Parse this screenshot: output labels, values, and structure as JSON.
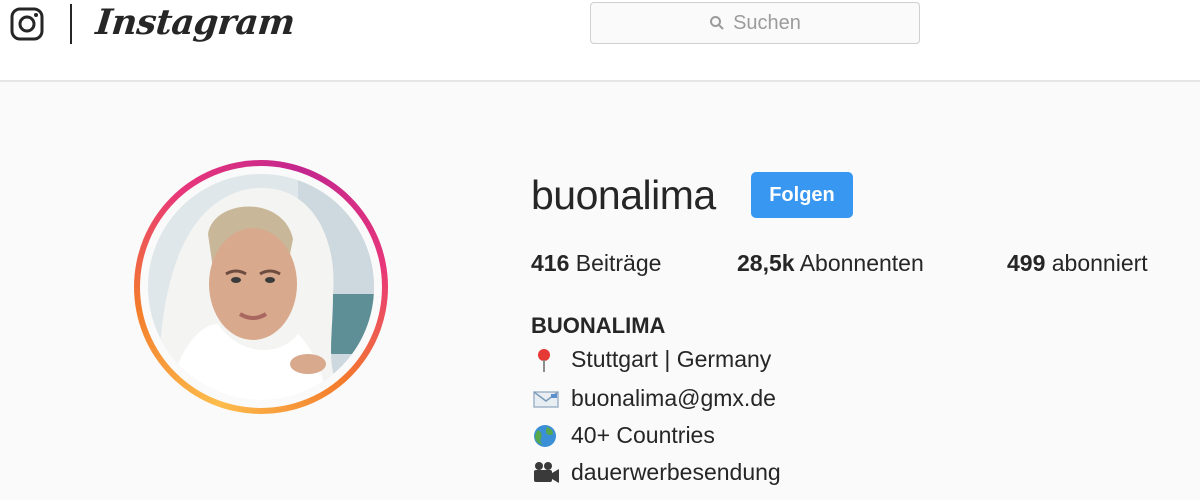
{
  "header": {
    "logo_icon": "instagram-camera-icon",
    "wordmark": "Instagram",
    "search": {
      "placeholder": "Suchen",
      "icon": "search-icon"
    }
  },
  "profile": {
    "username": "buonalima",
    "follow_label": "Folgen",
    "stats": [
      {
        "value": "416",
        "label": "Beiträge"
      },
      {
        "value": "28,5k",
        "label": "Abonnenten"
      },
      {
        "value": "499",
        "label": "abonniert"
      }
    ],
    "display_name": "BUONALIMA",
    "bio": [
      {
        "icon": "pin-icon",
        "text": "Stuttgart | Germany"
      },
      {
        "icon": "envelope-icon",
        "text": "buonalima@gmx.de"
      },
      {
        "icon": "globe-icon",
        "text": "40+ Countries"
      },
      {
        "icon": "video-camera-icon",
        "text": "dauerwerbesendung"
      }
    ]
  },
  "colors": {
    "accent": "#3897f0",
    "text": "#262626",
    "background": "#fafafa",
    "story_ring_start": "#fdbd4c",
    "story_ring_end": "#c3268e"
  }
}
